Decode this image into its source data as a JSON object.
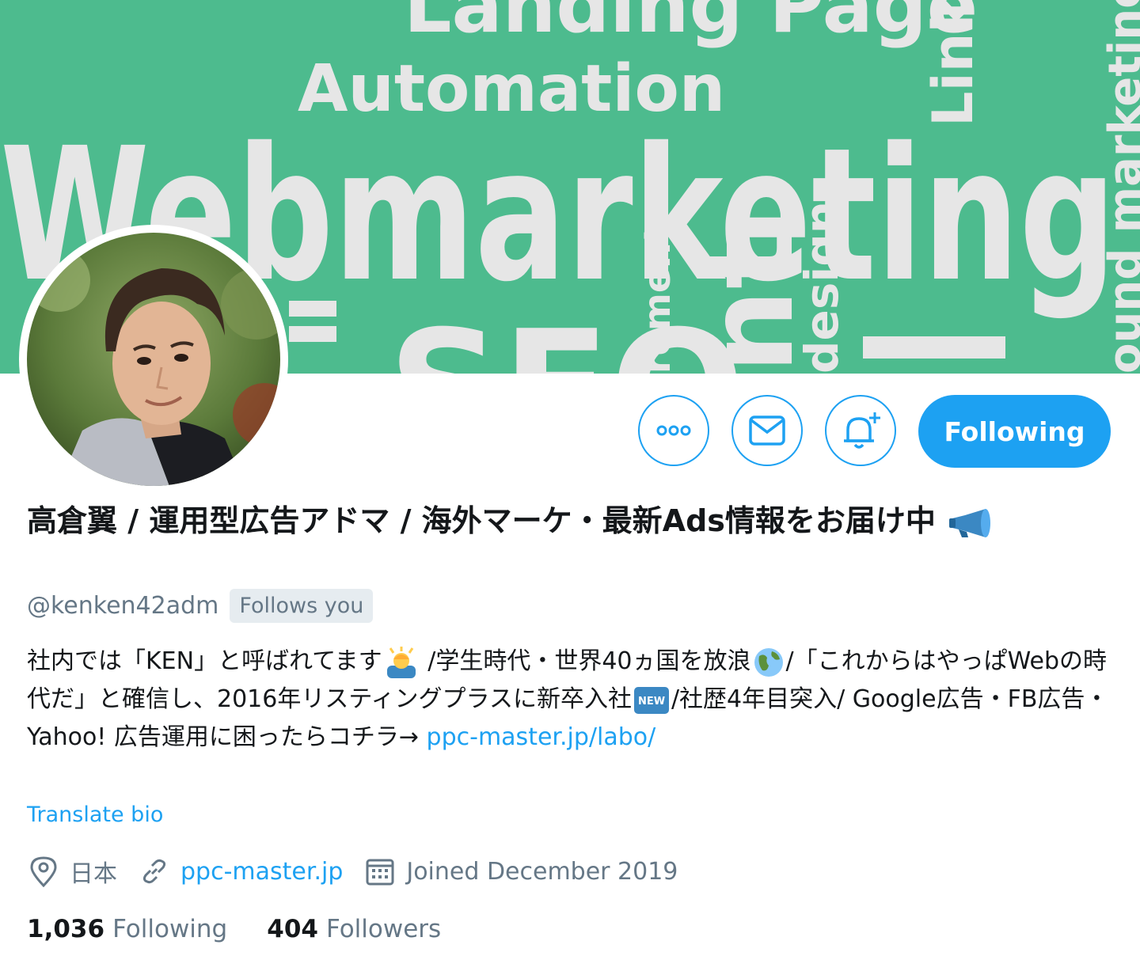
{
  "banner": {
    "words": [
      "Landing Page",
      "Automation",
      "Link b",
      "Webmarketing",
      "SEO",
      "nt",
      "rement",
      "design",
      "ound marketing"
    ]
  },
  "profile": {
    "name": "高倉翼 / 運用型広告アドマ / 海外マーケ・最新Ads情報をお届け中",
    "name_emoji": "megaphone-emoji",
    "handle": "@kenken42adm",
    "follows_you": "Follows you",
    "bio": {
      "part1": "社内では「KEN」と呼ばれてます",
      "part2": " /学生時代・世界40ヵ国を放浪",
      "part3": "/「これからはやっぱWebの時代だ」と確信し、2016年リスティングプラスに新卒入社",
      "part4": "/社歴4年目突入/ Google広告・FB広告・Yahoo! 広告運用に困ったらコチラ→ ",
      "link": "ppc-master.jp/labo/"
    },
    "translate_bio": "Translate bio",
    "location": "日本",
    "website": "ppc-master.jp",
    "joined": "Joined December 2019"
  },
  "actions": {
    "more_icon": "more-icon",
    "message_icon": "mail-icon",
    "notify_icon": "bell-plus-icon",
    "following_label": "Following"
  },
  "stats": {
    "following_count": "1,036",
    "following_label": "Following",
    "followers_count": "404",
    "followers_label": "Followers"
  },
  "colors": {
    "accent": "#1da1f2",
    "banner": "#4dbb8e",
    "text": "#14171a",
    "muted": "#657786"
  }
}
